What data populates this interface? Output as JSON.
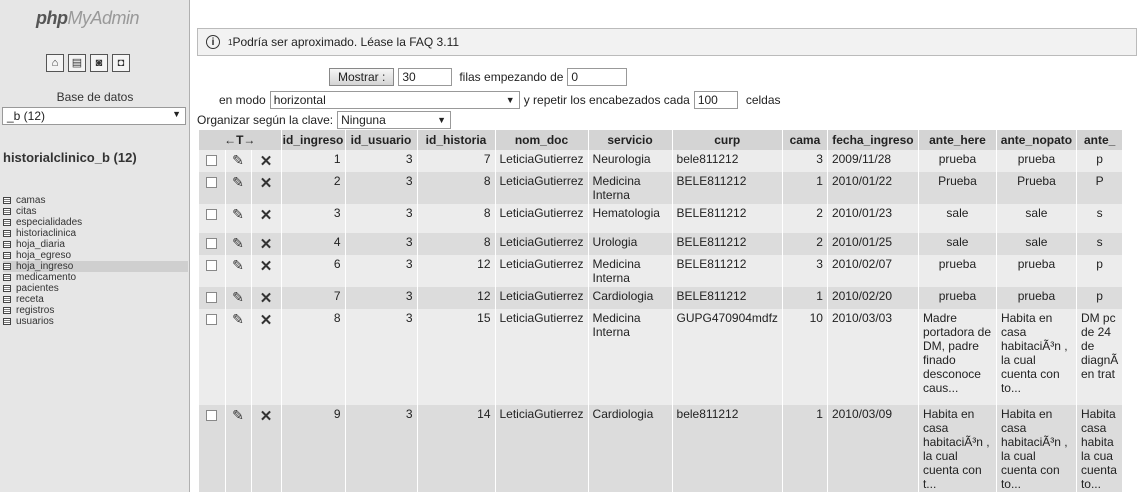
{
  "sidebar": {
    "logo_php": "php",
    "logo_my": "My",
    "logo_admin": "Admin",
    "icons": [
      "home-icon",
      "sql-icon",
      "docs-icon",
      "query-icon"
    ],
    "db_label": "Base de datos",
    "db_selected": "_b (12)",
    "db_title": "historialclinico_b (12)",
    "tables": [
      "camas",
      "citas",
      "especialidades",
      "historiaclinica",
      "hoja_diaria",
      "hoja_egreso",
      "hoja_ingreso",
      "medicamento",
      "pacientes",
      "receta",
      "registros",
      "usuarios"
    ],
    "active_table": "hoja_ingreso"
  },
  "notice": {
    "sup": "1",
    "text": "Podría ser aproximado. Léase la FAQ 3.11"
  },
  "controls": {
    "show_button": "Mostrar :",
    "rows_value": "30",
    "rows_label": "filas empezando de",
    "start_value": "0",
    "mode_label": "en modo",
    "mode_value": "horizontal",
    "repeat_label": "y repetir los encabezados cada",
    "repeat_value": "100",
    "cells_label": "celdas",
    "sort_label": "Organizar según la clave:",
    "sort_value": "Ninguna"
  },
  "table": {
    "action_header": "←T→",
    "columns": [
      "id_ingreso",
      "id_usuario",
      "id_historia",
      "nom_doc",
      "servicio",
      "curp",
      "cama",
      "fecha_ingreso",
      "ante_here",
      "ante_nopato",
      "ante_"
    ],
    "rows": [
      [
        "1",
        "3",
        "7",
        "LeticiaGutierrez",
        "Neurologia",
        "bele811212",
        "3",
        "2009/11/28",
        "prueba",
        "prueba",
        "p"
      ],
      [
        "2",
        "3",
        "8",
        "LeticiaGutierrez",
        "Medicina Interna",
        "BELE811212",
        "1",
        "2010/01/22",
        "Prueba",
        "Prueba",
        "P"
      ],
      [
        "3",
        "3",
        "8",
        "LeticiaGutierrez",
        "Hematologia",
        "BELE811212",
        "2",
        "2010/01/23",
        "sale",
        "sale",
        "s"
      ],
      [
        "4",
        "3",
        "8",
        "LeticiaGutierrez",
        "Urologia",
        "BELE811212",
        "2",
        "2010/01/25",
        "sale",
        "sale",
        "s"
      ],
      [
        "6",
        "3",
        "12",
        "LeticiaGutierrez",
        "Medicina Interna",
        "BELE811212",
        "3",
        "2010/02/07",
        "prueba",
        "prueba",
        "p"
      ],
      [
        "7",
        "3",
        "12",
        "LeticiaGutierrez",
        "Cardiologia",
        "BELE811212",
        "1",
        "2010/02/20",
        "prueba",
        "prueba",
        "p"
      ],
      [
        "8",
        "3",
        "15",
        "LeticiaGutierrez",
        "Medicina Interna",
        "GUPG470904mdfz",
        "10",
        "2010/03/03",
        "Madre portadora de DM, padre finado desconoce caus...",
        "Habita en casa habitaciÃ³n , la cual cuenta con to...",
        "DM pc de 24 de diagnÃ en trat"
      ],
      [
        "9",
        "3",
        "14",
        "LeticiaGutierrez",
        "Cardiologia",
        "bele811212",
        "1",
        "2010/03/09",
        "Habita en casa habitaciÃ³n , la cual cuenta con t...",
        "Habita en casa habitaciÃ³n , la cual cuenta con to...",
        "Habita casa habita la cua cuenta to..."
      ]
    ]
  }
}
